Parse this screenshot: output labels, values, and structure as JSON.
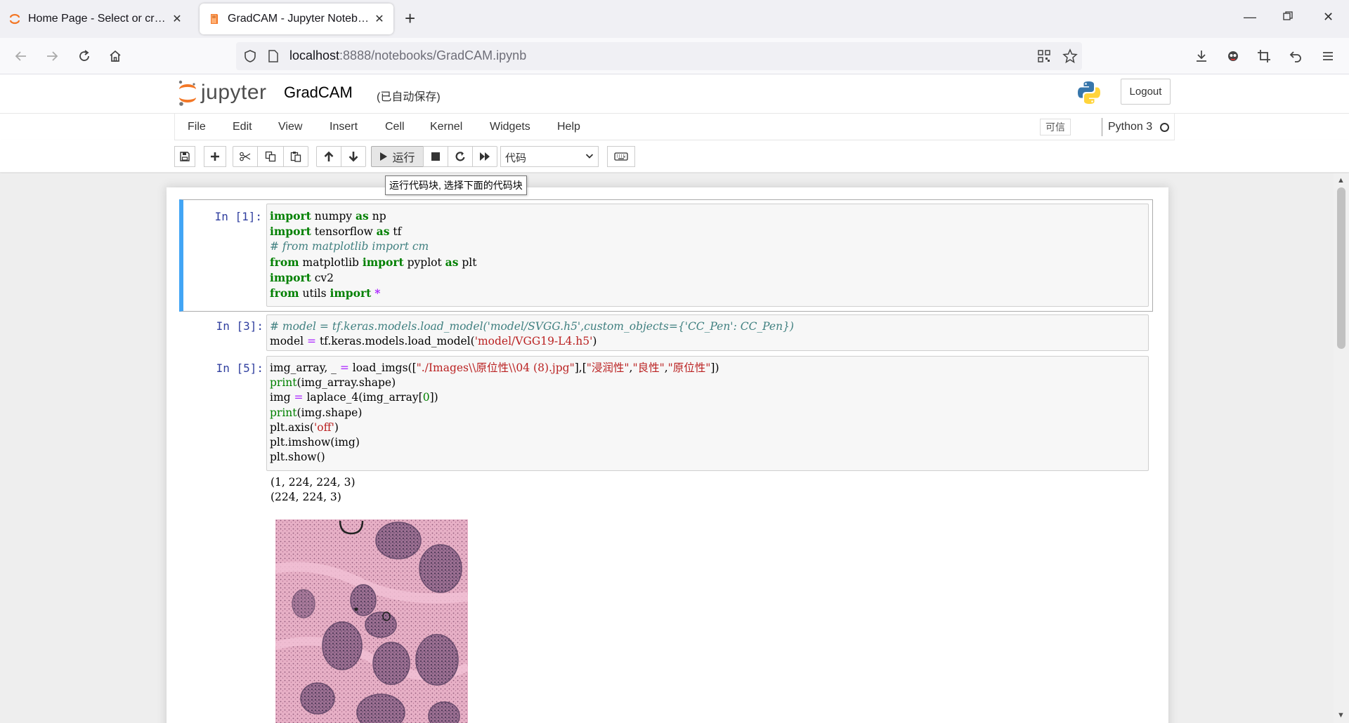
{
  "browser": {
    "tabs": [
      {
        "title": "Home Page - Select or create a notebook",
        "active": false
      },
      {
        "title": "GradCAM - Jupyter Notebook",
        "active": true
      }
    ],
    "url_host": "localhost",
    "url_rest": ":8888/notebooks/GradCAM.ipynb"
  },
  "jupyter": {
    "logo_text": "jupyter",
    "notebook_name": "GradCAM",
    "save_status": "(已自动保存)",
    "logout_label": "Logout",
    "menu": [
      "File",
      "Edit",
      "View",
      "Insert",
      "Cell",
      "Kernel",
      "Widgets",
      "Help"
    ],
    "trusted_label": "可信",
    "kernel_name": "Python 3",
    "run_label": "运行",
    "cell_type": "代码",
    "run_tooltip": "运行代码块, 选择下面的代码块"
  },
  "cells": [
    {
      "prompt": "In [1]:",
      "lines": [
        "import numpy as np",
        "import tensorflow as tf",
        "# from matplotlib import cm",
        "from matplotlib import pyplot as plt",
        "import cv2",
        "from utils import *"
      ]
    },
    {
      "prompt": "In [3]:",
      "lines": [
        "# model = tf.keras.models.load_model('model/SVGG.h5',custom_objects={'CC_Pen': CC_Pen})",
        "model = tf.keras.models.load_model('model/VGG19-L4.h5')"
      ]
    },
    {
      "prompt": "In [5]:",
      "lines": [
        "img_array, _ = load_imgs([\"./Images\\\\原位性\\\\04 (8).jpg\"],[\"浸润性\",\"良性\",\"原位性\"])",
        "print(img_array.shape)",
        "img = laplace_4(img_array[0])",
        "print(img.shape)",
        "plt.axis('off')",
        "plt.imshow(img)",
        "plt.show()"
      ],
      "output": [
        "(1, 224, 224, 3)",
        "(224, 224, 3)"
      ]
    }
  ],
  "colors": {
    "selected_border": "#42a5f5",
    "keyword": "#008000",
    "comment": "#408080",
    "string": "#ba2121",
    "prompt": "#303f9f"
  }
}
